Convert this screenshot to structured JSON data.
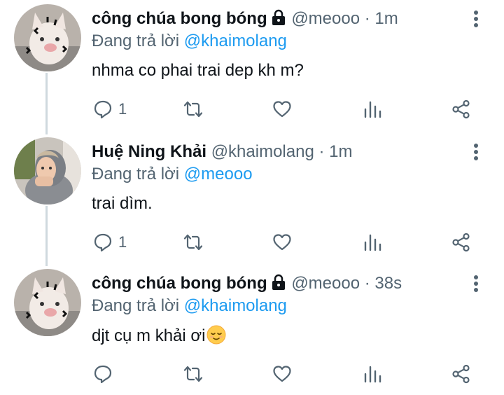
{
  "reply_prefix": "Đang trả lời",
  "tweets": [
    {
      "author": "công chúa bong bóng",
      "locked": true,
      "handle": "@meooo",
      "separator": "·",
      "time": "1m",
      "reply_to": "@khaimolang",
      "text": "nhma co phai trai dep kh m?",
      "reply_count": "1",
      "avatar": "cat-avatar"
    },
    {
      "author": "Huệ Ning Khải",
      "locked": false,
      "handle": "@khaimolang",
      "separator": "·",
      "time": "1m",
      "reply_to": "@meooo",
      "text": "trai dìm.",
      "reply_count": "1",
      "avatar": "person-avatar"
    },
    {
      "author": "công chúa bong bóng",
      "locked": true,
      "handle": "@meooo",
      "separator": "·",
      "time": "38s",
      "reply_to": "@khaimolang",
      "text": "djt cụ m khải ơi",
      "emoji": "relieved-face-emoji",
      "reply_count": "",
      "avatar": "cat-avatar"
    }
  ],
  "icons": {
    "reply": "reply-icon",
    "retweet": "retweet-icon",
    "like": "like-icon",
    "analytics": "analytics-icon",
    "share": "share-icon",
    "more": "more-icon",
    "lock": "lock-icon"
  },
  "colors": {
    "text": "#0f1419",
    "muted": "#536471",
    "mention": "#1d9bf0",
    "thread_line": "#cfd9de"
  }
}
